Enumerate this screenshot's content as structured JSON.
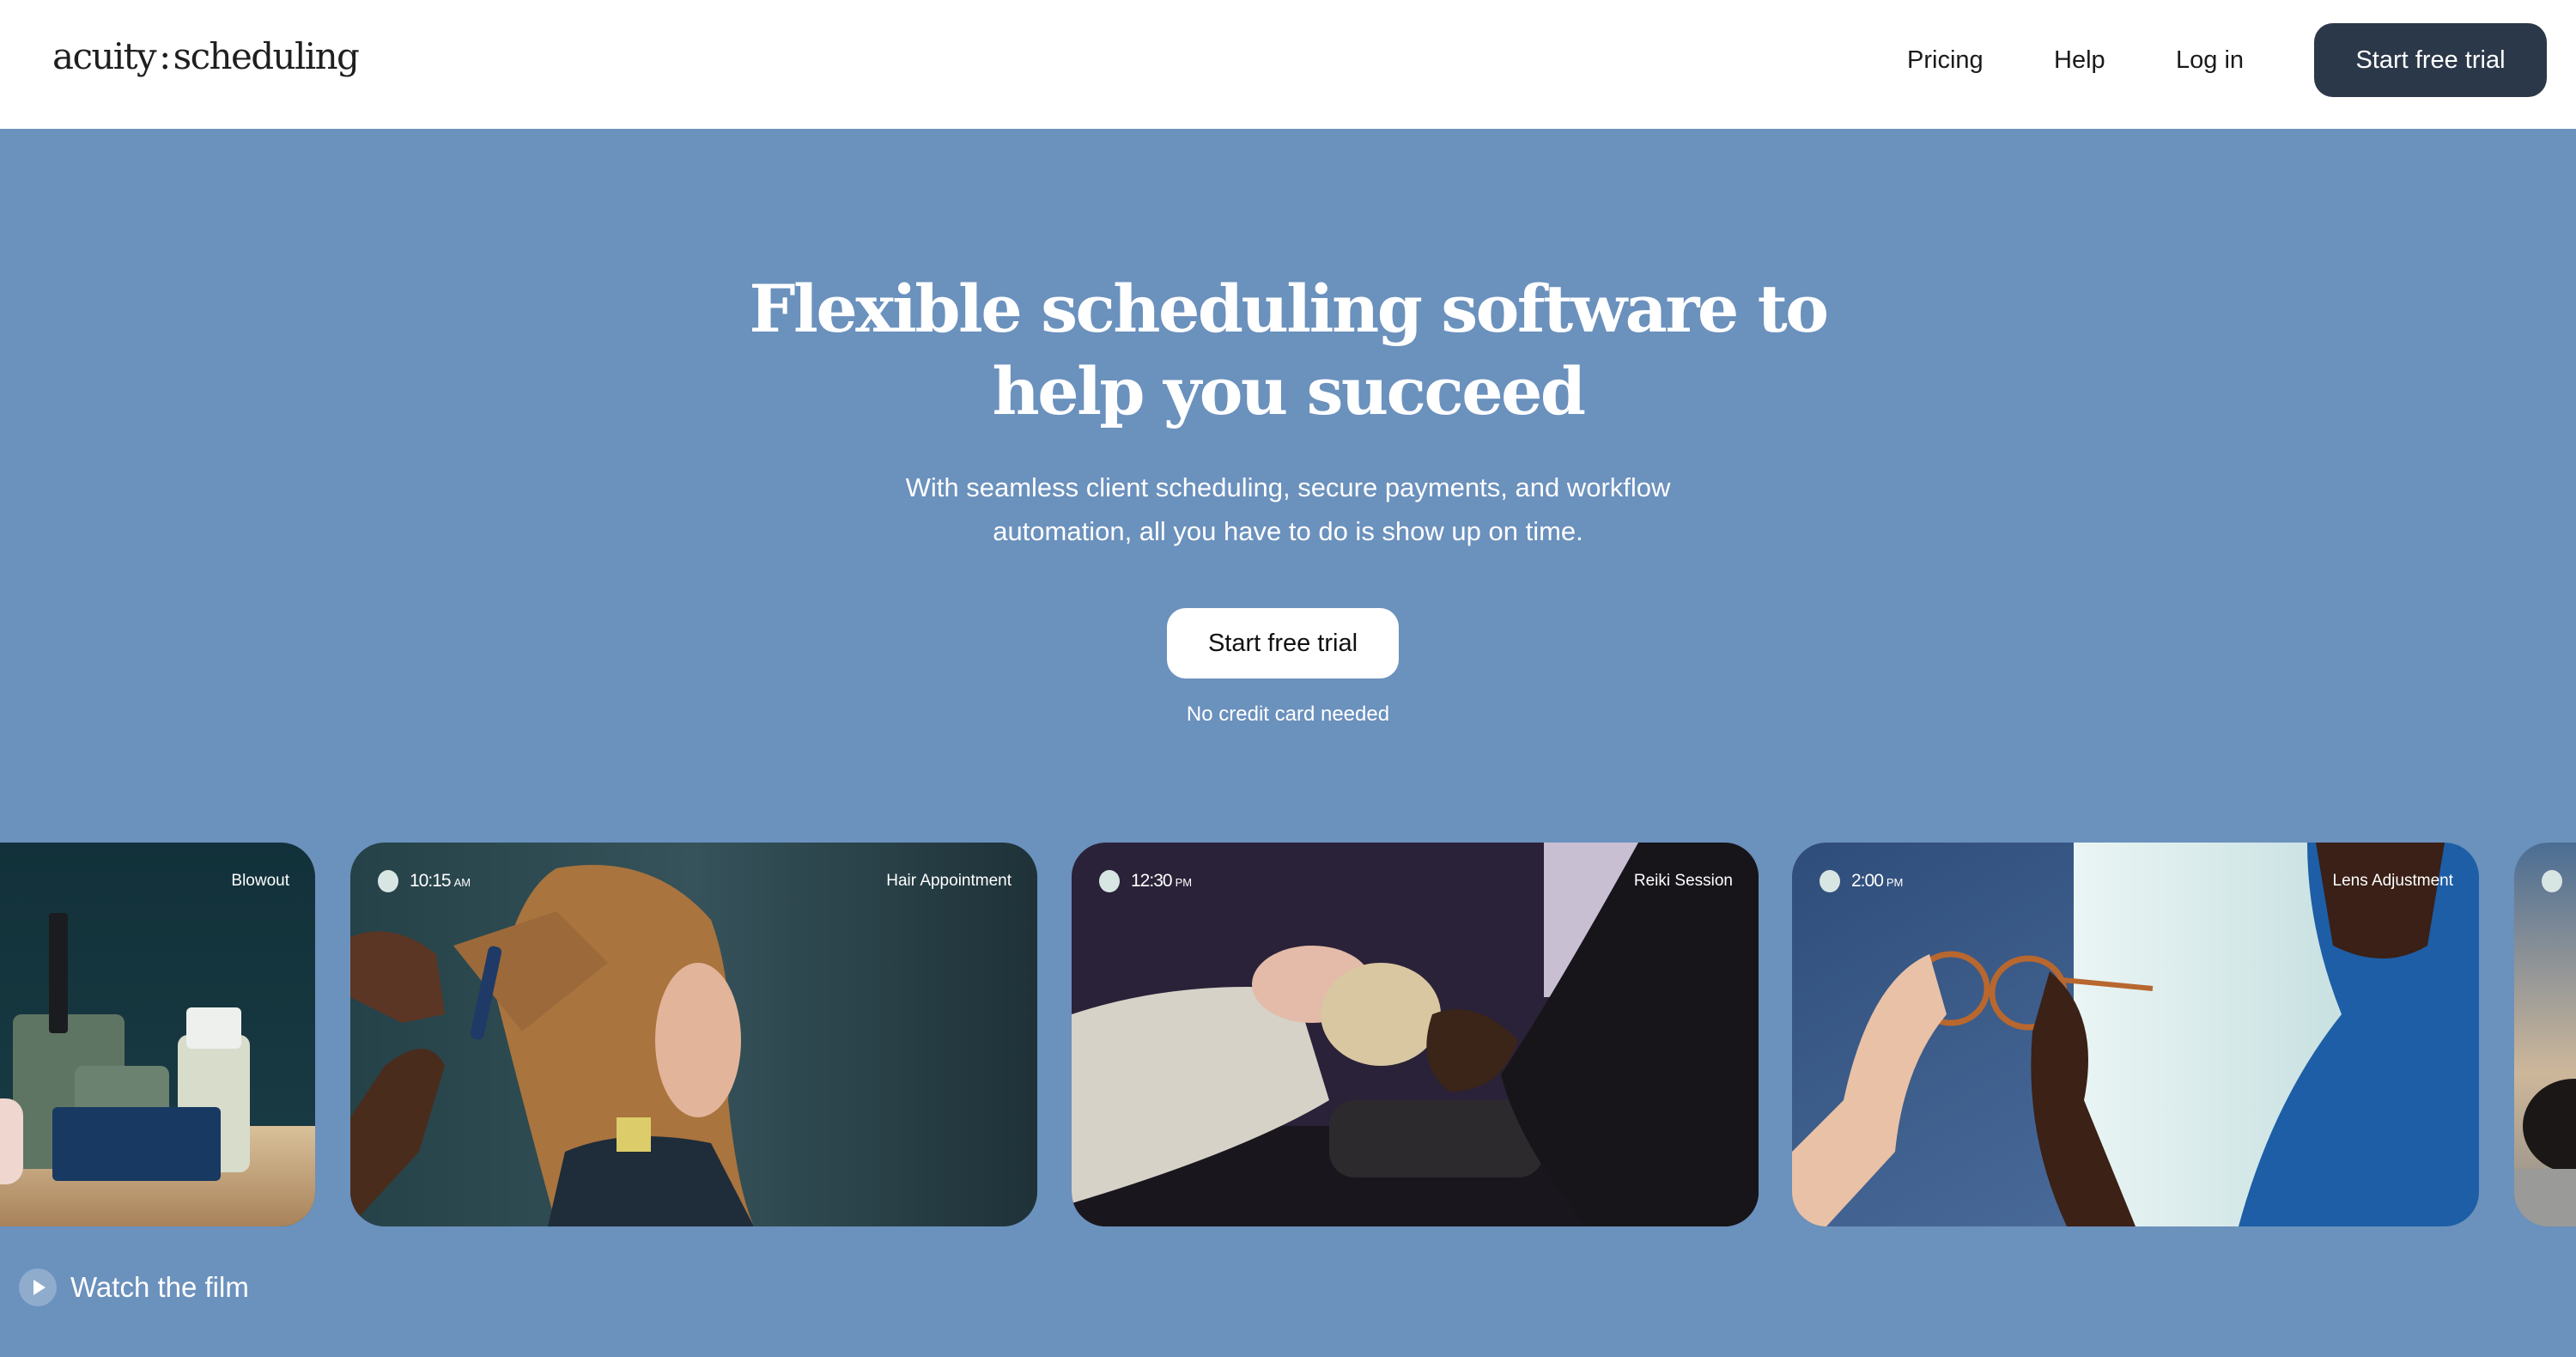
{
  "header": {
    "logo": {
      "left": "acuity",
      "sep": ":",
      "right": "scheduling"
    },
    "nav": [
      {
        "label": "Pricing"
      },
      {
        "label": "Help"
      },
      {
        "label": "Log in"
      }
    ],
    "cta_label": "Start free trial"
  },
  "hero": {
    "title_lines": [
      "Flexible scheduling software to",
      "help you succeed"
    ],
    "subtitle_lines": [
      "With seamless client scheduling, secure payments, and workflow",
      "automation, all you have to do is show up on time."
    ],
    "cta_label": "Start free trial",
    "note": "No credit card needed"
  },
  "cards": [
    {
      "label": "Blowout",
      "time": "",
      "ampm": ""
    },
    {
      "label": "Hair Appointment",
      "time": "10:15",
      "ampm": "AM"
    },
    {
      "label": "Reiki Session",
      "time": "12:30",
      "ampm": "PM"
    },
    {
      "label": "Lens Adjustment",
      "time": "2:00",
      "ampm": "PM"
    },
    {
      "label": "",
      "time": "",
      "ampm": ""
    }
  ],
  "watch_film": {
    "label": "Watch the film",
    "icon": "play-icon"
  },
  "colors": {
    "background": "#6b91bd",
    "header_bg": "#ffffff",
    "header_cta_bg": "#2b3849",
    "text_dark": "#1a1a1a",
    "text_light": "#ffffff"
  }
}
